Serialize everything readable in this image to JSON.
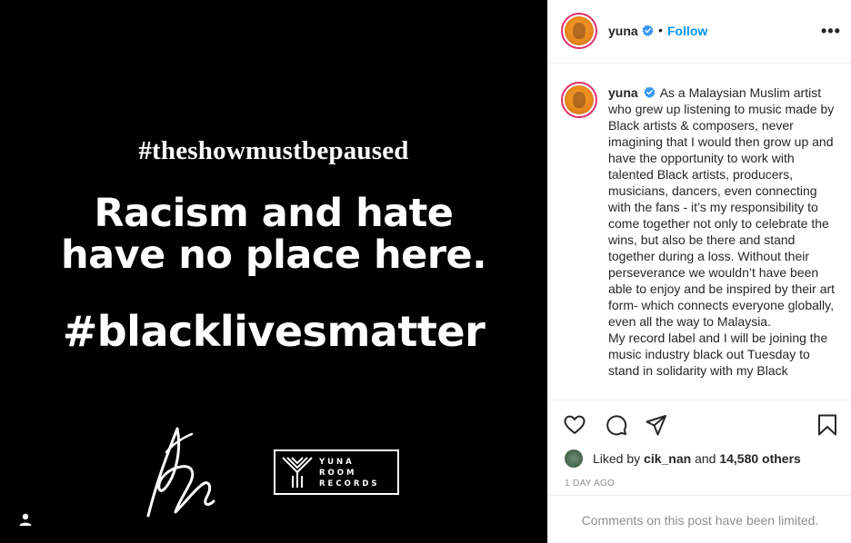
{
  "post": {
    "image": {
      "hashtag_top": "#theshowmustbepaused",
      "headline_line1": "Racism and hate",
      "headline_line2": "have no place here.",
      "hashtag_bottom": "#blacklivesmatter",
      "label_logo_lines": [
        "YUNA",
        "ROOM",
        "RECORDS"
      ],
      "signature_icon": "signature-icon",
      "tagged_user_icon": "tagged-user-icon"
    },
    "header": {
      "username": "yuna",
      "separator": "•",
      "follow_label": "Follow",
      "more_label": "•••"
    },
    "caption": {
      "username": "yuna",
      "text": "As a Malaysian Muslim artist who grew up listening to music made by Black artists & composers, never imagining that I would then grow up and have the opportunity to work with talented Black artists, producers, musicians, dancers, even connecting with the fans - it’s my responsibility to come together not only to celebrate the wins, but also be there and stand together during a loss. Without their perseverance we wouldn’t have been able to enjoy and be inspired by their art form- which connects everyone globally, even all the way to Malaysia.",
      "text2": "My record label and I will be joining the music industry black out Tuesday to stand in solidarity with my Black"
    },
    "actions": {
      "like_icon": "heart-icon",
      "comment_icon": "comment-icon",
      "share_icon": "share-icon",
      "save_icon": "bookmark-icon"
    },
    "likes": {
      "prefix": "Liked by",
      "user": "cik_nan",
      "conjunction": "and",
      "count": "14,580 others"
    },
    "timestamp": "1 DAY AGO",
    "comments_notice": "Comments on this post have been limited."
  },
  "colors": {
    "follow_blue": "#0095f6",
    "verified_blue": "#3897f0",
    "media_background": "#000000",
    "muted_text": "#8e8e8e"
  }
}
